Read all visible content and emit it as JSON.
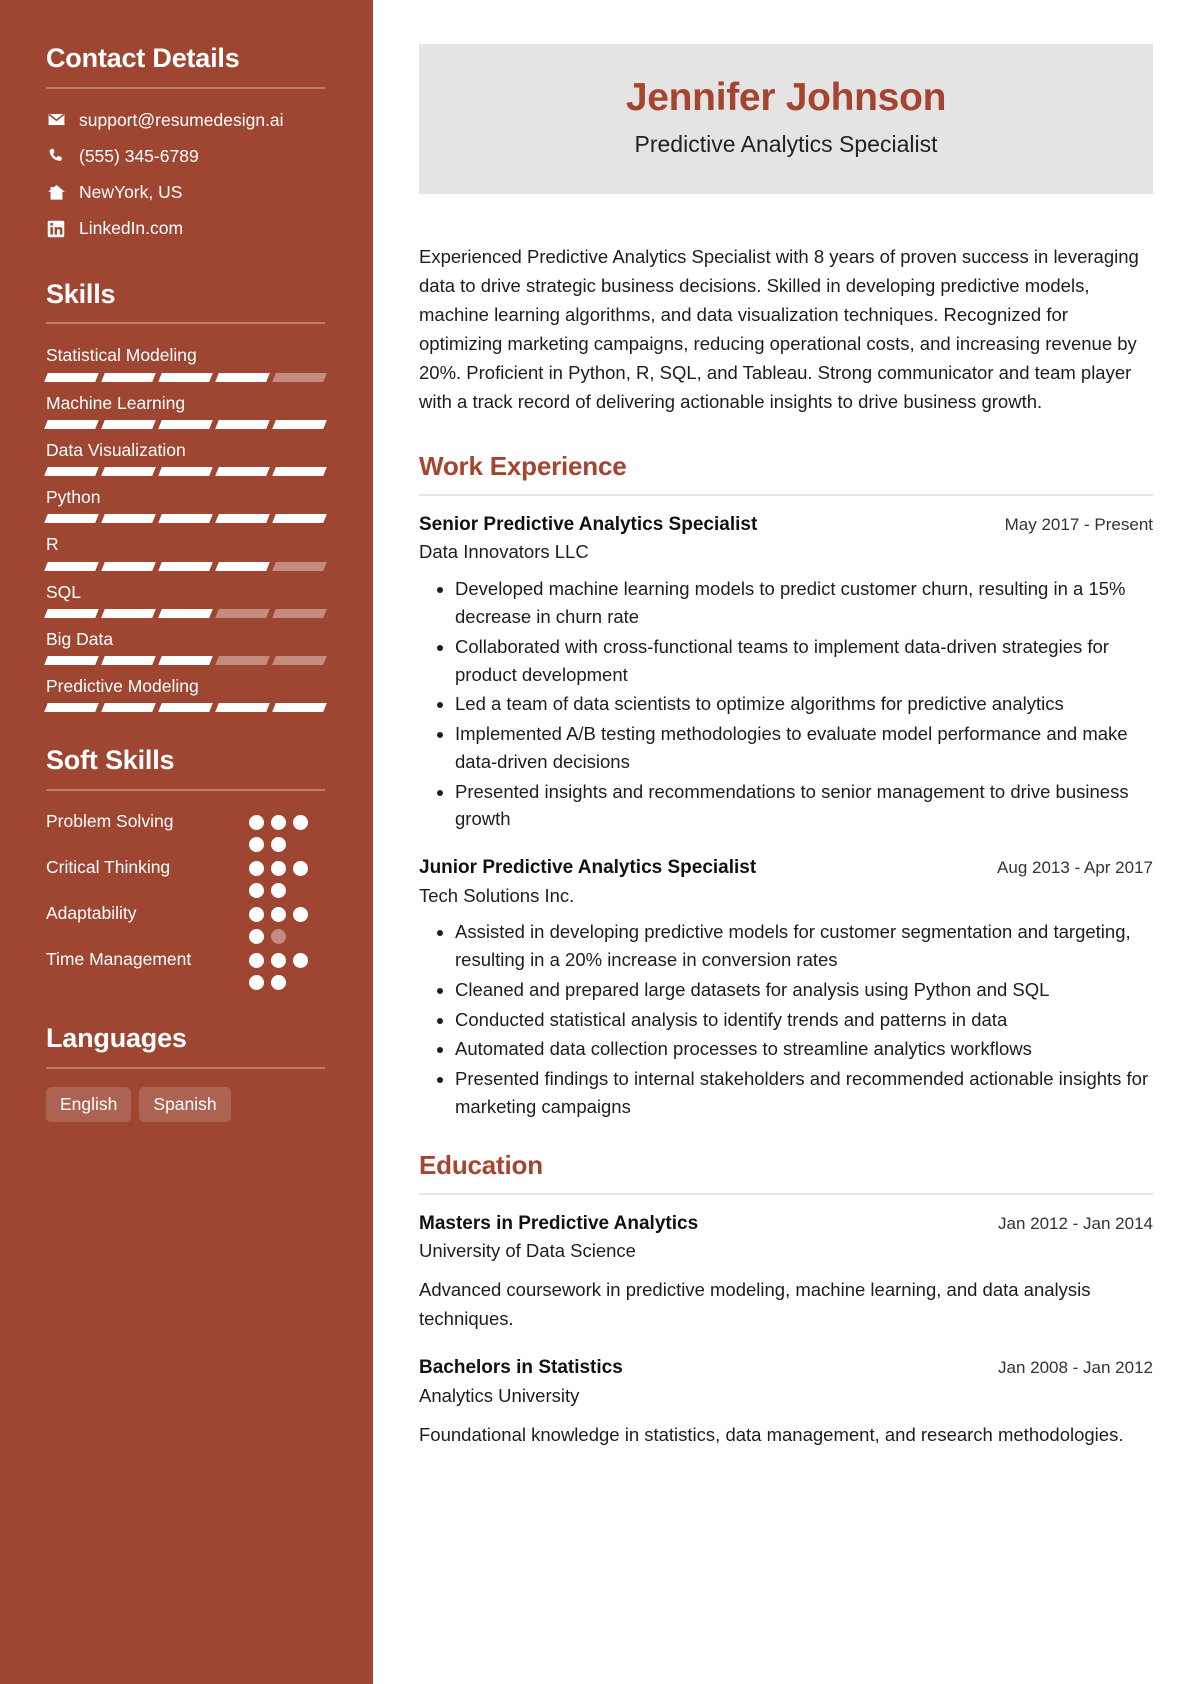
{
  "theme": {
    "sidebar_bg": "#9e4631",
    "accent": "#a5452f",
    "name_card_bg": "#e4e4e4",
    "text": "#1d1d1d"
  },
  "sidebar": {
    "contact": {
      "heading": "Contact Details",
      "items": [
        {
          "icon": "envelope-icon",
          "value": "support@resumedesign.ai"
        },
        {
          "icon": "phone-icon",
          "value": "(555) 345-6789"
        },
        {
          "icon": "home-icon",
          "value": "NewYork, US"
        },
        {
          "icon": "linkedin-icon",
          "value": "LinkedIn.com"
        }
      ]
    },
    "skills": {
      "heading": "Skills",
      "max": 5,
      "items": [
        {
          "label": "Statistical Modeling",
          "level": 4
        },
        {
          "label": "Machine Learning",
          "level": 5
        },
        {
          "label": "Data Visualization",
          "level": 5
        },
        {
          "label": "Python",
          "level": 5
        },
        {
          "label": "R",
          "level": 4
        },
        {
          "label": "SQL",
          "level": 3
        },
        {
          "label": "Big Data",
          "level": 3
        },
        {
          "label": "Predictive Modeling",
          "level": 5
        }
      ]
    },
    "soft_skills": {
      "heading": "Soft Skills",
      "max": 5,
      "items": [
        {
          "label": "Problem Solving",
          "level": 5
        },
        {
          "label": "Critical Thinking",
          "level": 5
        },
        {
          "label": "Adaptability",
          "level": 4
        },
        {
          "label": "Time Management",
          "level": 5
        }
      ]
    },
    "languages": {
      "heading": "Languages",
      "items": [
        "English",
        "Spanish"
      ]
    }
  },
  "header": {
    "name": "Jennifer Johnson",
    "title": "Predictive Analytics Specialist"
  },
  "summary": "Experienced Predictive Analytics Specialist with 8 years of proven success in leveraging data to drive strategic business decisions. Skilled in developing predictive models, machine learning algorithms, and data visualization techniques. Recognized for optimizing marketing campaigns, reducing operational costs, and increasing revenue by 20%. Proficient in Python, R, SQL, and Tableau. Strong communicator and team player with a track record of delivering actionable insights to drive business growth.",
  "work_experience": {
    "heading": "Work Experience",
    "entries": [
      {
        "title": "Senior Predictive Analytics Specialist",
        "date": "May 2017 - Present",
        "company": "Data Innovators LLC",
        "bullets": [
          "Developed machine learning models to predict customer churn, resulting in a 15% decrease in churn rate",
          "Collaborated with cross-functional teams to implement data-driven strategies for product development",
          "Led a team of data scientists to optimize algorithms for predictive analytics",
          "Implemented A/B testing methodologies to evaluate model performance and make data-driven decisions",
          "Presented insights and recommendations to senior management to drive business growth"
        ]
      },
      {
        "title": "Junior Predictive Analytics Specialist",
        "date": "Aug 2013 - Apr 2017",
        "company": "Tech Solutions Inc.",
        "bullets": [
          "Assisted in developing predictive models for customer segmentation and targeting, resulting in a 20% increase in conversion rates",
          "Cleaned and prepared large datasets for analysis using Python and SQL",
          "Conducted statistical analysis to identify trends and patterns in data",
          "Automated data collection processes to streamline analytics workflows",
          "Presented findings to internal stakeholders and recommended actionable insights for marketing campaigns"
        ]
      }
    ]
  },
  "education": {
    "heading": "Education",
    "entries": [
      {
        "title": "Masters in Predictive Analytics",
        "date": "Jan 2012 - Jan 2014",
        "school": "University of Data Science",
        "description": "Advanced coursework in predictive modeling, machine learning, and data analysis techniques."
      },
      {
        "title": "Bachelors in Statistics",
        "date": "Jan 2008 - Jan 2012",
        "school": "Analytics University",
        "description": "Foundational knowledge in statistics, data management, and research methodologies."
      }
    ]
  }
}
